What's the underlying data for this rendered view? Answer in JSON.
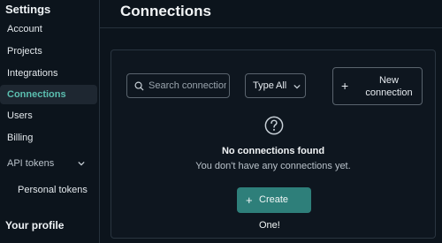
{
  "sidebar": {
    "title": "Settings",
    "items": [
      {
        "label": "Account"
      },
      {
        "label": "Projects"
      },
      {
        "label": "Integrations"
      },
      {
        "label": "Connections",
        "active": true
      },
      {
        "label": "Users"
      },
      {
        "label": "Billing"
      }
    ],
    "api_tokens": {
      "label": "API tokens",
      "expanded": true,
      "icon": "chevron-down-icon"
    },
    "personal_tokens": "Personal tokens",
    "profile_heading": "Your profile"
  },
  "page": {
    "title": "Connections"
  },
  "filters": {
    "search_placeholder": "Search connections",
    "search_value": "",
    "search_icon": "search-icon",
    "type_label": "Type",
    "type_value": "All",
    "type_icon": "chevron-down-icon"
  },
  "new_connection": {
    "plus": "+",
    "label": "New connection"
  },
  "empty_state": {
    "icon": "question-circle-icon",
    "title": "No connections found",
    "subtitle": "You don't have any connections yet.",
    "create_plus": "+",
    "create_label": "Create One!"
  },
  "colors": {
    "background": "#0c141c",
    "accent": "#2e7f7a",
    "active_text": "#5bbfb0",
    "border": "#5a646e"
  }
}
